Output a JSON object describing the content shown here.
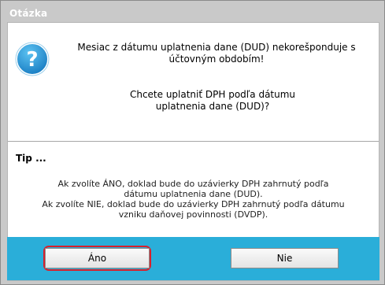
{
  "dialog": {
    "title": "Otázka",
    "message_line1": "Mesiac z dátumu uplatnenia dane (DUD) nekorešponduje s",
    "message_line2": "účtovným obdobím!",
    "question_line1": "Chcete uplatniť DPH podľa dátumu",
    "question_line2": "uplatnenia dane (DUD)?",
    "icon": "question-icon",
    "tip": {
      "title": "Tip ...",
      "line1": "Ak zvolíte ÁNO, doklad bude do uzávierky DPH zahrnutý podľa",
      "line2": "dátumu uplatnenia dane (DUD).",
      "line3": "Ak zvolíte NIE, doklad bude do uzávierky DPH zahrnutý podľa dátumu",
      "line4": "vzniku daňovej povinnosti (DVDP)."
    },
    "buttons": {
      "yes_label": "Áno",
      "no_label": "Nie"
    },
    "colors": {
      "footer": "#2aaed9",
      "icon": "#1f8fce",
      "highlight": "#d9202b"
    }
  }
}
